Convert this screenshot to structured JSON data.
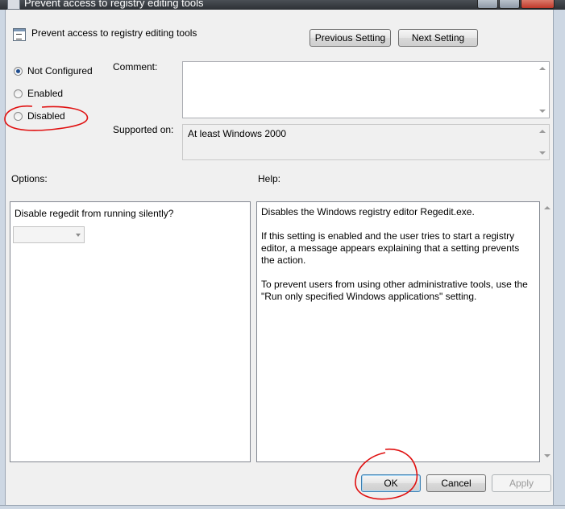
{
  "window": {
    "title": "Prevent access to registry editing tools"
  },
  "header": {
    "policy_name": "Prevent access to registry editing tools"
  },
  "nav": {
    "previous": "Previous Setting",
    "next": "Next Setting"
  },
  "state": {
    "options": [
      {
        "label": "Not Configured",
        "checked": true
      },
      {
        "label": "Enabled",
        "checked": false
      },
      {
        "label": "Disabled",
        "checked": false
      }
    ]
  },
  "comment": {
    "label": "Comment:",
    "value": ""
  },
  "supported": {
    "label": "Supported on:",
    "value": "At least Windows 2000"
  },
  "options_section": {
    "label": "Options:",
    "prompt": "Disable regedit from running silently?",
    "dropdown_value": ""
  },
  "help_section": {
    "label": "Help:",
    "text": "Disables the Windows registry editor Regedit.exe.\n\nIf this setting is enabled and the user tries to start a registry editor, a message appears explaining that a setting prevents the action.\n\nTo prevent users from using other administrative tools, use the \"Run only specified Windows applications\" setting."
  },
  "footer": {
    "ok": "OK",
    "cancel": "Cancel",
    "apply": "Apply"
  },
  "colors": {
    "annotation": "#e01010",
    "title_bar": "#2c3035",
    "focus_border": "#3c7fb1"
  }
}
